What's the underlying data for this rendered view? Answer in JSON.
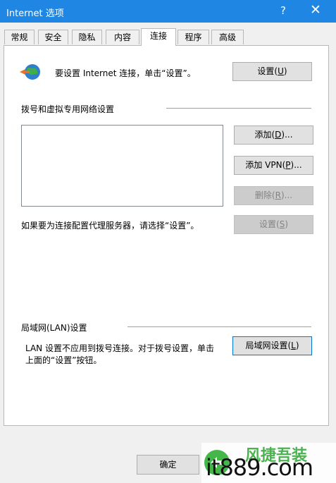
{
  "window": {
    "title": "Internet 选项",
    "help": "?",
    "close": "✕"
  },
  "tabs": [
    "常规",
    "安全",
    "隐私",
    "内容",
    "连接",
    "程序",
    "高级"
  ],
  "active_tab": "连接",
  "setup": {
    "text": "要设置 Internet 连接，单击“设置”。",
    "button_main": "设置(",
    "button_key": "U",
    "button_end": ")"
  },
  "dialup": {
    "title": "拨号和虚拟专用网络设置",
    "add_main": "添加(",
    "add_key": "D",
    "add_end": ")...",
    "vpn_main": "添加 VPN(",
    "vpn_key": "P",
    "vpn_end": ")...",
    "remove_main": "删除(",
    "remove_key": "R",
    "remove_end": ")...",
    "proxy_text": "如果要为连接配置代理服务器，请选择“设置”。",
    "settings_main": "设置(",
    "settings_key": "S",
    "settings_end": ")"
  },
  "lan": {
    "title": "局域网(LAN)设置",
    "line1": "LAN 设置不应用到拨号连接。对于拨号设置，单击",
    "line2": "上面的“设置”按钮。",
    "button_main": "局域网设置(",
    "button_key": "L",
    "button_end": ")"
  },
  "footer": {
    "ok": "确定"
  },
  "watermark": {
    "text": "it889.com",
    "brand": "风捷吾装"
  }
}
